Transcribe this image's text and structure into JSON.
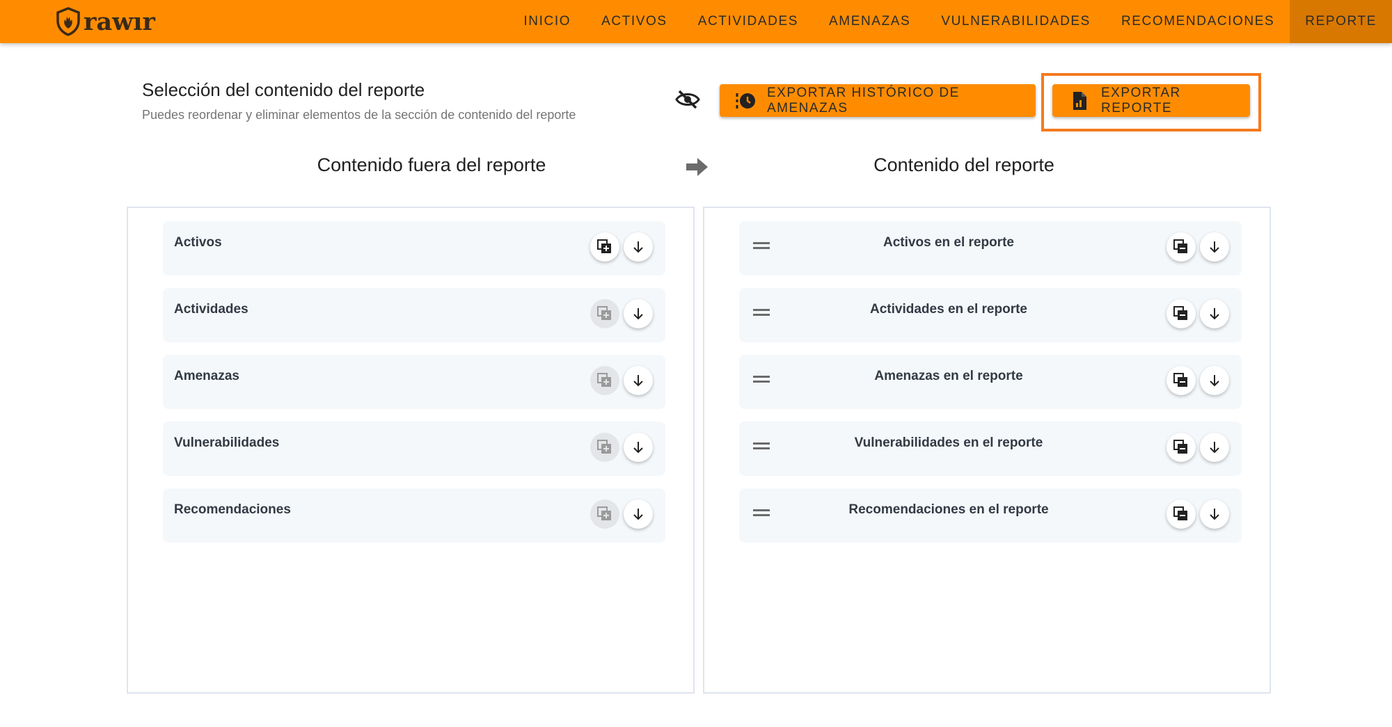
{
  "brand": {
    "logo_text": "rawır"
  },
  "nav": {
    "items": [
      {
        "label": "INICIO"
      },
      {
        "label": "ACTIVOS"
      },
      {
        "label": "ACTIVIDADES"
      },
      {
        "label": "AMENAZAS"
      },
      {
        "label": "VULNERABILIDADES"
      },
      {
        "label": "RECOMENDACIONES"
      },
      {
        "label": "REPORTE",
        "active": true
      }
    ]
  },
  "header": {
    "title": "Selección del contenido del reporte",
    "subtitle": "Puedes reordenar y eliminar elementos de la sección de contenido del reporte"
  },
  "actions": {
    "export_history_label": "EXPORTAR HISTÓRICO DE AMENAZAS",
    "export_report_label": "EXPORTAR REPORTE"
  },
  "columns": {
    "left_title": "Contenido fuera del reporte",
    "right_title": "Contenido del reporte"
  },
  "outside_items": [
    {
      "label": "Activos",
      "add_enabled": true
    },
    {
      "label": "Actividades",
      "add_enabled": false
    },
    {
      "label": "Amenazas",
      "add_enabled": false
    },
    {
      "label": "Vulnerabilidades",
      "add_enabled": false
    },
    {
      "label": "Recomendaciones",
      "add_enabled": false
    }
  ],
  "report_items": [
    {
      "label": "Activos en el reporte"
    },
    {
      "label": "Actividades en el reporte"
    },
    {
      "label": "Amenazas en el reporte"
    },
    {
      "label": "Vulnerabilidades en el reporte"
    },
    {
      "label": "Recomendaciones en el reporte"
    }
  ],
  "colors": {
    "topbar": "#FF8C00",
    "active_nav": "#D97800",
    "highlight": "#F47A1F",
    "item_bg": "#f4f8fb"
  },
  "icons": {
    "logo": "shield-flame-icon",
    "visibility": "eye-off-icon",
    "history": "history-icon",
    "report": "file-chart-icon",
    "between_columns": "arrow-right-icon",
    "add_copy": "copy-add-icon",
    "remove_copy": "copy-remove-icon",
    "move_down": "arrow-down-icon",
    "drag": "drag-handle-icon"
  }
}
